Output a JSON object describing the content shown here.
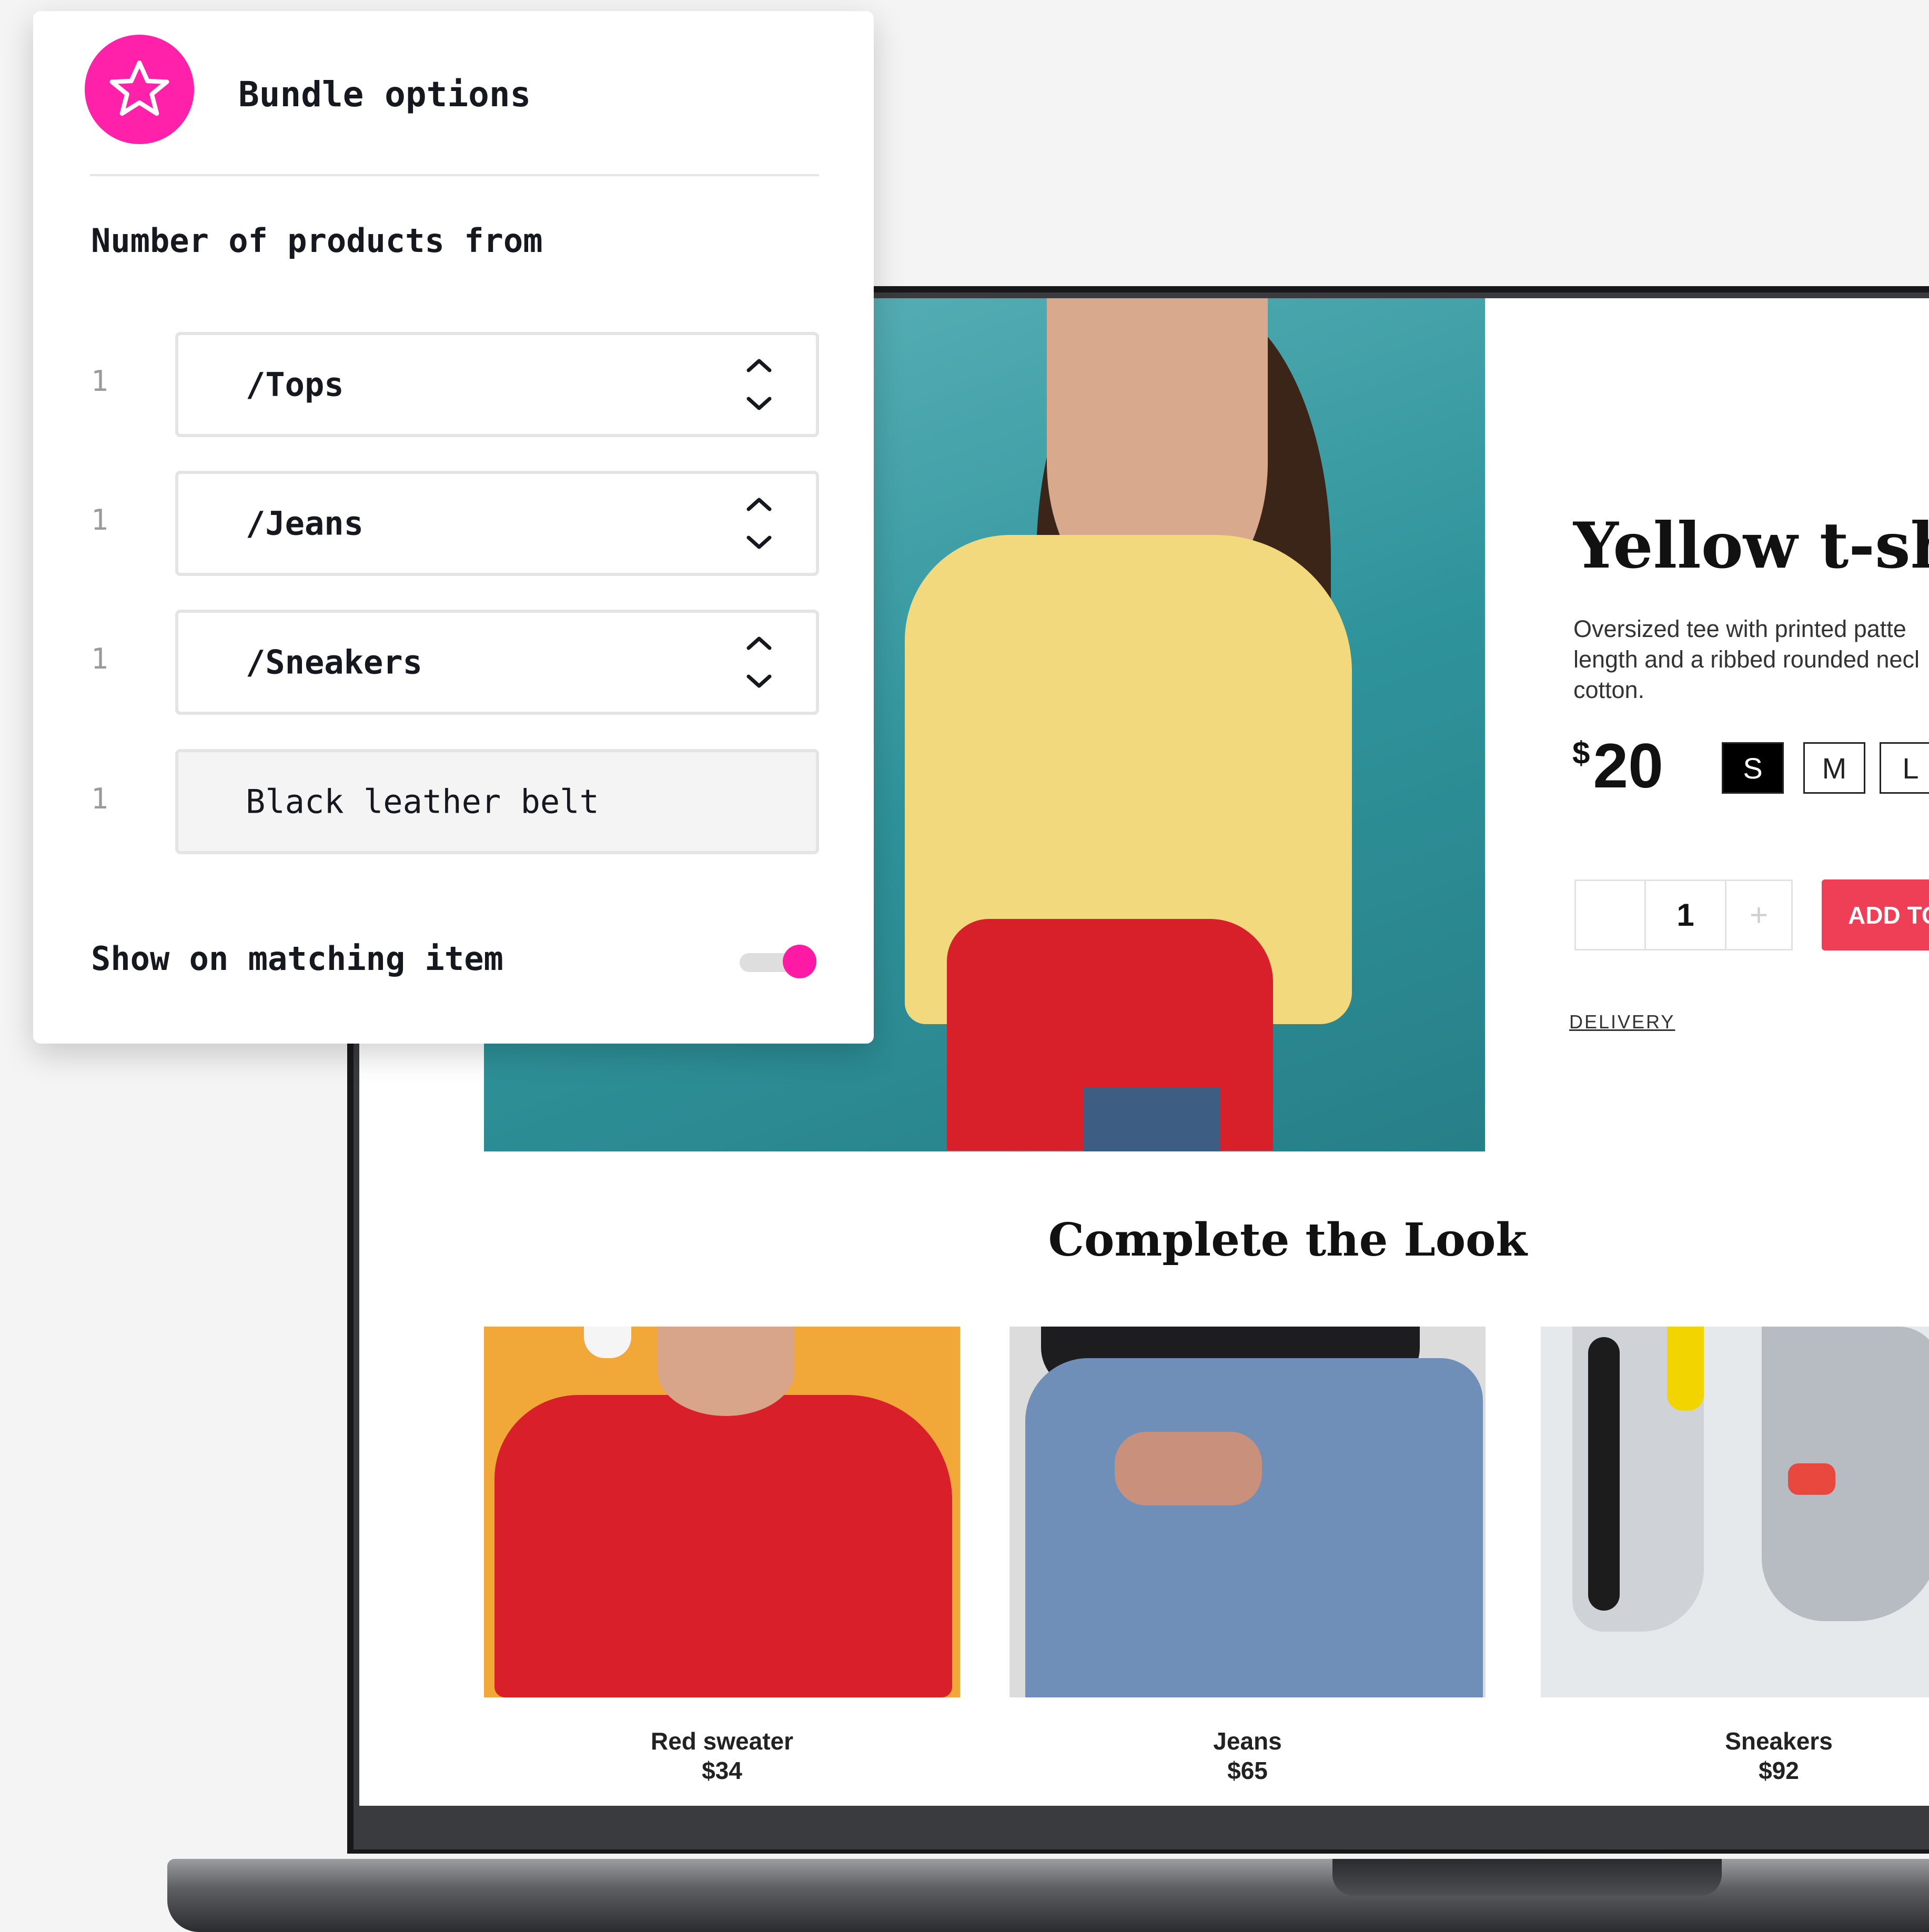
{
  "bundle_panel": {
    "title": "Bundle options",
    "section_label": "Number of products from",
    "rows": [
      {
        "count": "1",
        "value": "/Tops"
      },
      {
        "count": "1",
        "value": "/Jeans"
      },
      {
        "count": "1",
        "value": "/Sneakers"
      },
      {
        "count": "1",
        "value": "Black leather belt"
      }
    ],
    "toggle_label": "Show on matching item",
    "toggle_on": true,
    "accent_color": "#ff21a9",
    "logo_icon": "star-icon"
  },
  "product": {
    "title": "Yellow t-shi",
    "description": "Oversized tee with printed patte length and a ribbed rounded necl cotton.",
    "price_currency": "$",
    "price_amount": "20",
    "sizes": [
      {
        "label": "S",
        "selected": true
      },
      {
        "label": "M",
        "selected": false
      },
      {
        "label": "L",
        "selected": false
      }
    ],
    "quantity": "1",
    "qty_plus": "+",
    "add_to_cart": "ADD TO",
    "add_color": "#ee3f56",
    "delivery_link": "DELIVERY"
  },
  "complete_the_look": {
    "title": "Complete the Look",
    "items": [
      {
        "name": "Red sweater",
        "price": "$34"
      },
      {
        "name": "Jeans",
        "price": "$65"
      },
      {
        "name": "Sneakers",
        "price": "$92"
      }
    ]
  }
}
